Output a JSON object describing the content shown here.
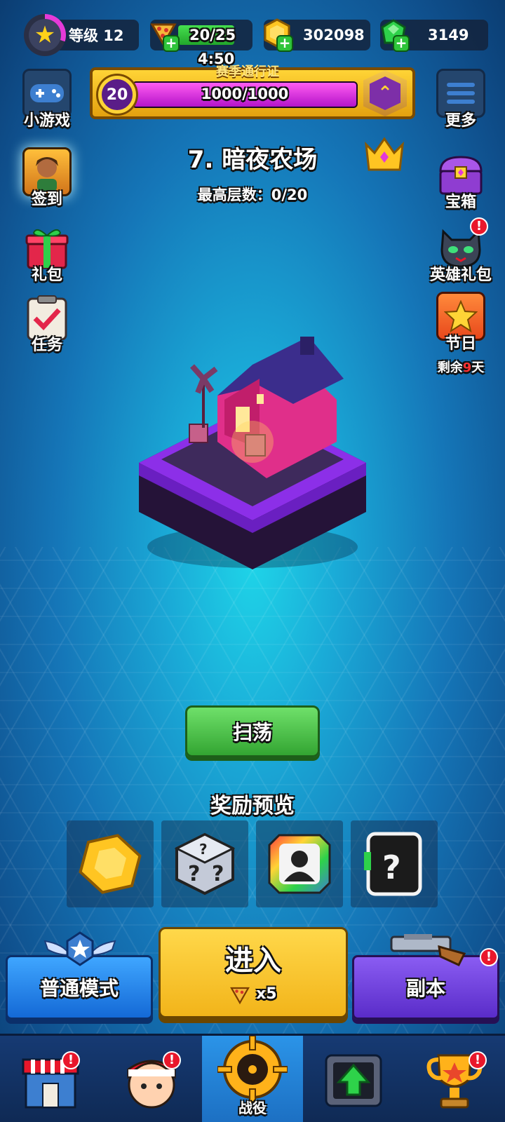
{
  "top_bar": {
    "level_label": "等级 12",
    "energy": "20/25",
    "energy_fraction": 0.8,
    "gold": "302098",
    "gems": "3149",
    "timer": "4:50"
  },
  "season_pass": {
    "title": "赛季通行证",
    "level": "20",
    "progress": "1000/1000",
    "progress_fraction": 1.0
  },
  "left_menu": [
    {
      "label": "小游戏",
      "icon": "gamepad-icon"
    },
    {
      "label": "签到",
      "icon": "hero-portrait-icon"
    },
    {
      "label": "礼包",
      "icon": "gift-icon"
    },
    {
      "label": "任务",
      "icon": "clipboard-check-icon"
    }
  ],
  "right_menu": [
    {
      "label": "更多",
      "icon": "menu-icon"
    },
    {
      "label": "宝箱",
      "icon": "chest-icon"
    },
    {
      "label": "英雄礼包",
      "icon": "panther-icon"
    },
    {
      "label": "节日",
      "icon": "star-icon"
    }
  ],
  "festival_remaining": {
    "prefix": "剩余",
    "days": "9",
    "suffix": "天"
  },
  "stage": {
    "title": "7. 暗夜农场",
    "floor_label": "最高层数：0/20"
  },
  "sweep_label": "扫荡",
  "reward_title": "奖励预览",
  "rewards": [
    {
      "icon": "gold-coin-icon"
    },
    {
      "icon": "mystery-dice-icon"
    },
    {
      "icon": "hero-silhouette-icon"
    },
    {
      "icon": "mystery-card-icon"
    }
  ],
  "mode": {
    "normal_label": "普通模式",
    "enter_label": "进入",
    "enter_cost": "x5",
    "dungeon_label": "副本"
  },
  "nav": {
    "active_label": "战役",
    "items": [
      "shop-icon",
      "hero-icon",
      "campaign-icon",
      "upgrade-icon",
      "trophy-icon"
    ]
  },
  "colors": {
    "accent_gold": "#ffd436",
    "pass_purple": "#e33ad8",
    "sweep_green": "#33a532",
    "normal_blue": "#1469d6",
    "dungeon_purple": "#5a2cc9",
    "alert_red": "#e9172b"
  }
}
